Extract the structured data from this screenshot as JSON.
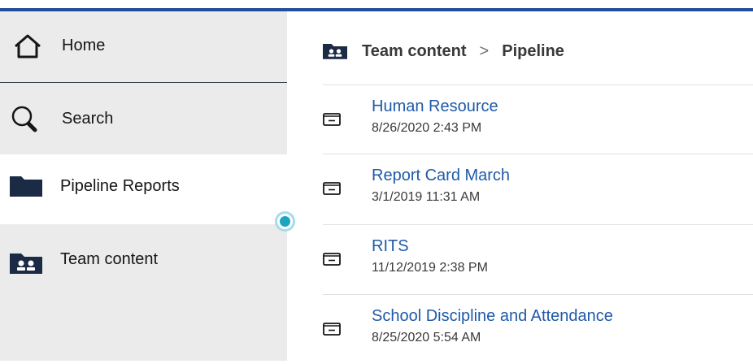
{
  "sidebar": {
    "items": [
      {
        "label": "Home",
        "icon": "home-icon"
      },
      {
        "label": "Search",
        "icon": "search-icon"
      },
      {
        "label": "Pipeline Reports",
        "icon": "folder-icon"
      },
      {
        "label": "Team content",
        "icon": "team-folder-icon"
      }
    ]
  },
  "breadcrumb": {
    "icon": "team-folder-icon",
    "parent": "Team content",
    "separator": ">",
    "current": "Pipeline"
  },
  "list": {
    "items": [
      {
        "title": "Human Resource",
        "date": "8/26/2020 2:43 PM",
        "icon": "report-icon"
      },
      {
        "title": "Report Card March",
        "date": "3/1/2019 11:31 AM",
        "icon": "report-icon"
      },
      {
        "title": "RITS",
        "date": "11/12/2019 2:38 PM",
        "icon": "report-icon"
      },
      {
        "title": "School Discipline and Attendance",
        "date": "8/25/2020 5:54 AM",
        "icon": "report-icon"
      }
    ]
  },
  "colors": {
    "top_bar": "#1f4e9a",
    "link": "#1f5aa8",
    "nav_bg": "#ebebeb",
    "handle": "#1aa5c4",
    "icon_dark": "#1c2b45"
  }
}
